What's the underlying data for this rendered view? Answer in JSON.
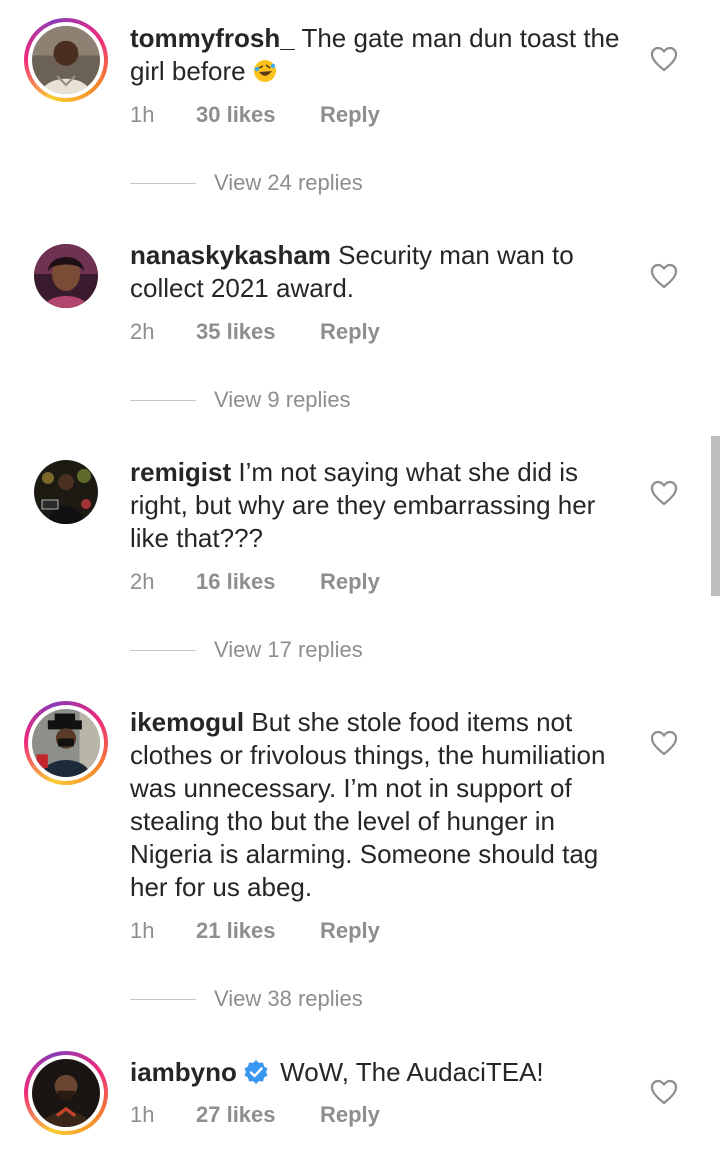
{
  "comments": [
    {
      "username": "tommyfrosh_",
      "text": "The gate man dun toast the girl before",
      "emoji": "rofl-emoji",
      "time": "1h",
      "likes": "30 likes",
      "reply": "Reply",
      "view_replies": "View 24 replies"
    },
    {
      "username": "nanaskykasham",
      "text": "Security man wan to collect 2021 award.",
      "time": "2h",
      "likes": "35 likes",
      "reply": "Reply",
      "view_replies": "View 9 replies"
    },
    {
      "username": "remigist",
      "text": "I’m not saying what she did is right, but why are they embarrassing her like that???",
      "time": "2h",
      "likes": "16 likes",
      "reply": "Reply",
      "view_replies": "View 17 replies"
    },
    {
      "username": "ikemogul",
      "text": "But she stole food items not clothes or frivolous things, the humiliation was unnecessary. I’m not in support of stealing tho but the level of hunger in Nigeria is alarming. Someone should tag her for us abeg.",
      "time": "1h",
      "likes": "21 likes",
      "reply": "Reply",
      "view_replies": "View 38 replies"
    },
    {
      "username": "iambyno",
      "verified": true,
      "text": "WoW, The AudaciTEA!",
      "time": "1h",
      "likes": "27 likes",
      "reply": "Reply"
    }
  ],
  "colors": {
    "text": "#262626",
    "muted": "#8e8e8e",
    "verified": "#3897f0",
    "story_ring": "#ee2a7b"
  },
  "icons": [
    "heart-outline-icon",
    "verified-badge-icon",
    "rofl-emoji"
  ]
}
